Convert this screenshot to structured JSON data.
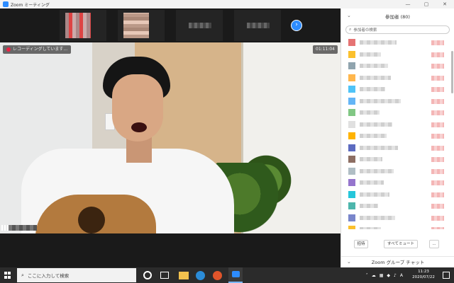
{
  "window": {
    "title": "Zoom ミーティング",
    "controls": [
      "—",
      "▢",
      "✕"
    ]
  },
  "video": {
    "recording_label": "レコーディングしています...",
    "timer": "01:11:04"
  },
  "participants": {
    "header": "参加者 (80)",
    "search_placeholder": "参加者の検索",
    "avatar_colors": [
      "#e57373",
      "#fbc02d",
      "#90a4ae",
      "#ffb74d",
      "#4fc3f7",
      "#64b5f6",
      "#81c784",
      "#e0e0e0",
      "#ffb300",
      "#5c6bc0",
      "#8d6e63",
      "#b0bec5",
      "#9575cd",
      "#26c6da",
      "#4db6ac",
      "#7986cb",
      "#fbc02d"
    ],
    "buttons": {
      "invite": "招待",
      "mute_all": "すべてミュート",
      "more": "..."
    }
  },
  "chat": {
    "header": "Zoom グループ チャット"
  },
  "taskbar": {
    "search_placeholder": "ここに入力して検索",
    "time": "11:23",
    "date": "2020/07/22",
    "ime": "A"
  },
  "colors": {
    "accent": "#2d8cff",
    "taskbar": "#2b2b2b",
    "record": "#e24444"
  }
}
